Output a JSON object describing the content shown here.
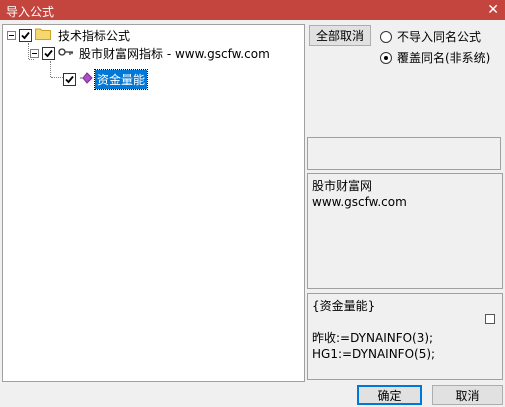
{
  "window": {
    "title": "导入公式",
    "close_glyph": "✕"
  },
  "tree": {
    "root_label": "技术指标公式",
    "group_label": "股市财富网指标 - www.gscfw.com",
    "item_label": "资金量能"
  },
  "options": {
    "deselect_all_label": "全部取消",
    "radio_skip_label": "不导入同名公式",
    "radio_overwrite_label": "覆盖同名(非系统)",
    "selected": "overwrite"
  },
  "info_panel": {
    "line1": "股市财富网",
    "line2": "www.gscfw.com"
  },
  "code_panel": {
    "line1": "{资金量能}",
    "line2": "",
    "line3": "昨收:=DYNAINFO(3);",
    "line4": "HG1:=DYNAINFO(5);"
  },
  "buttons": {
    "ok_label": "确定",
    "cancel_label": "取消"
  },
  "colors": {
    "titlebar": "#c4453e",
    "selection": "#0078d7"
  }
}
